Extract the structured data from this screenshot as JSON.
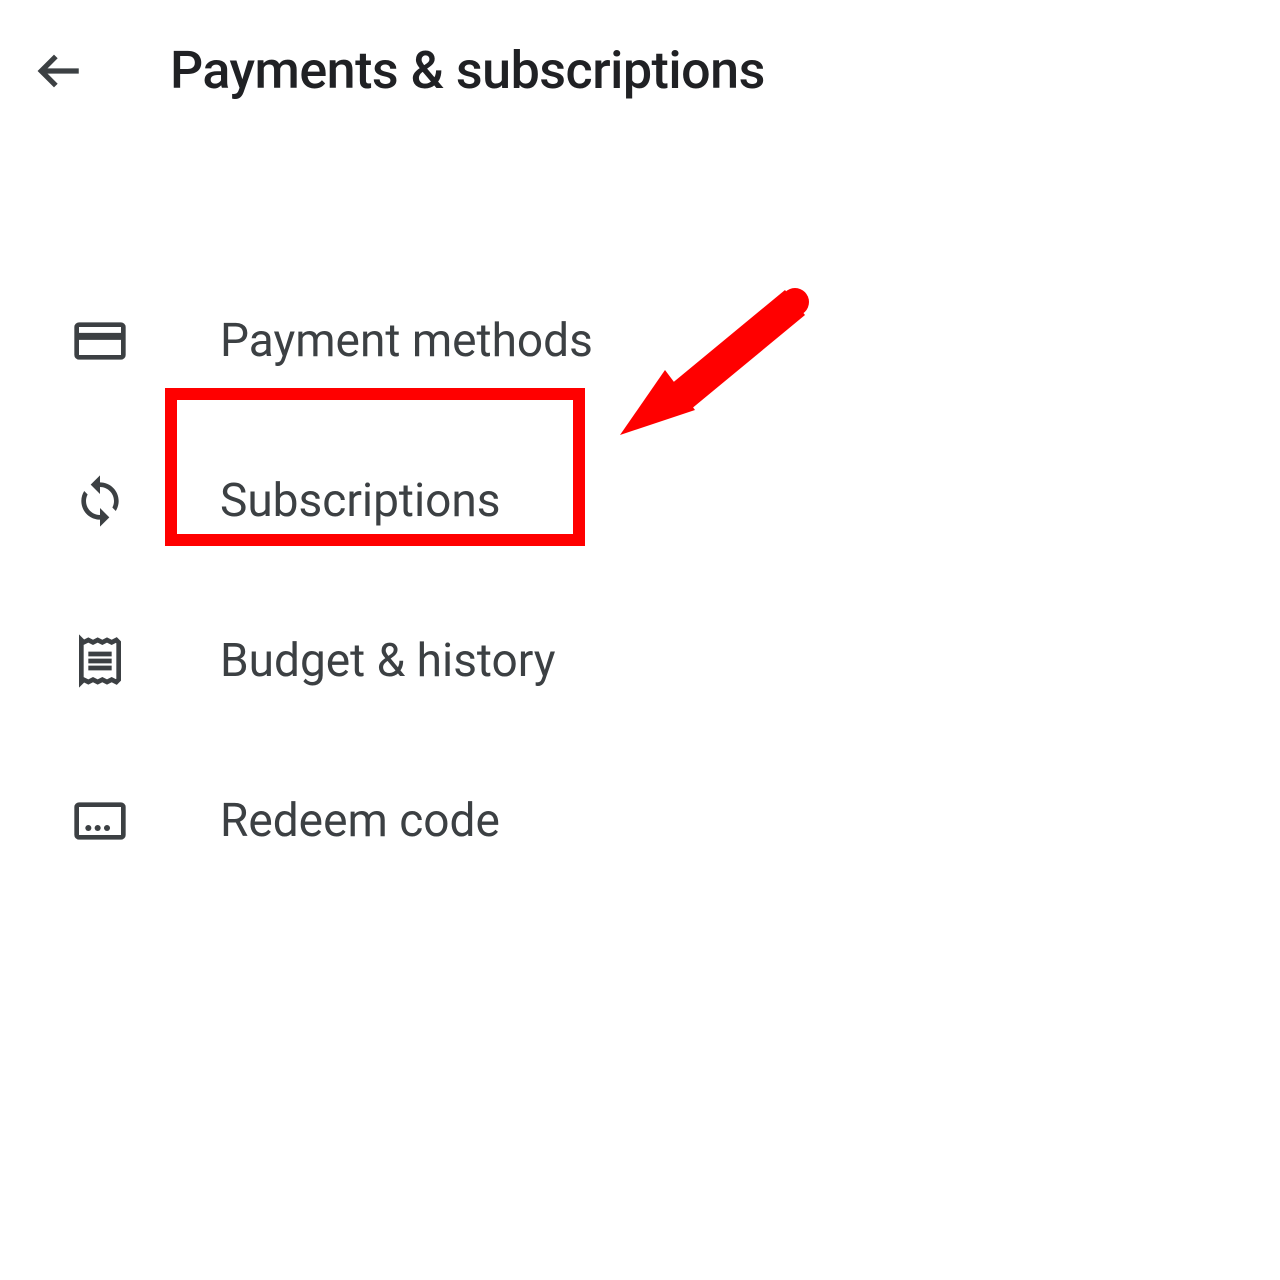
{
  "header": {
    "title": "Payments & subscriptions"
  },
  "menu": {
    "items": [
      {
        "label": "Payment methods",
        "icon": "credit-card-icon"
      },
      {
        "label": "Subscriptions",
        "icon": "sync-icon"
      },
      {
        "label": "Budget & history",
        "icon": "receipt-icon"
      },
      {
        "label": "Redeem code",
        "icon": "ellipsis-card-icon"
      }
    ]
  },
  "annotation": {
    "highlight_target": "Subscriptions",
    "arrow_color": "#ff0000"
  }
}
